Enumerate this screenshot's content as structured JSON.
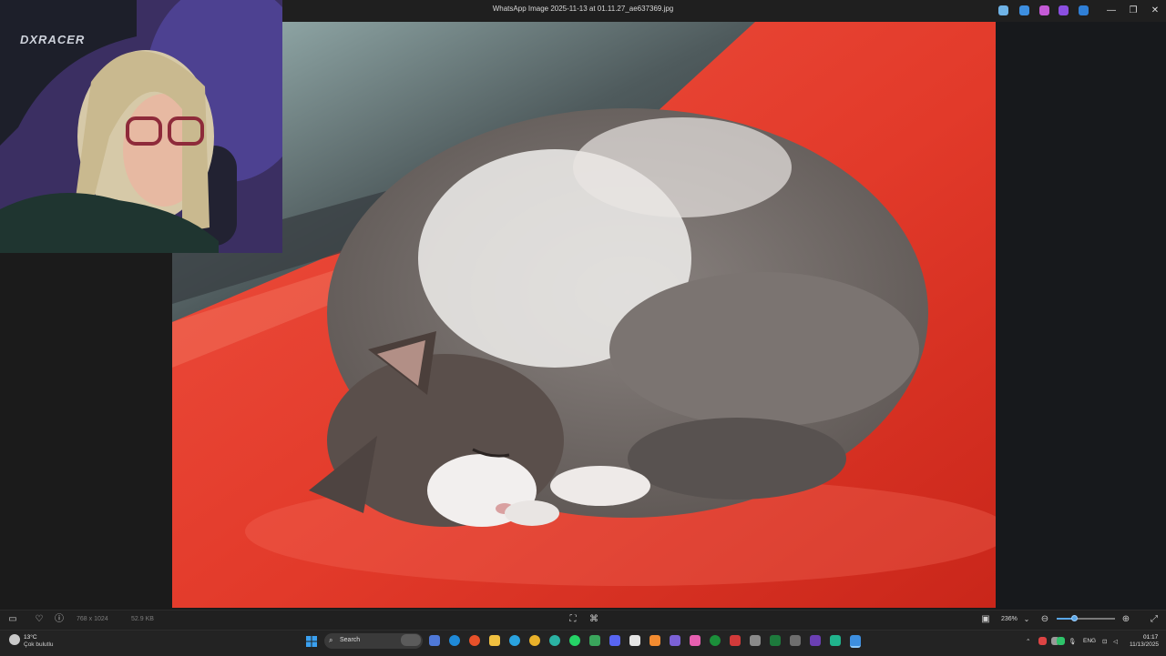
{
  "window": {
    "title": "WhatsApp Image 2025-11-13 at 01.11.27_ae637369.jpg",
    "controls": {
      "minimize": "—",
      "restore": "❐",
      "close": "✕"
    }
  },
  "webcam": {
    "chair_brand": "DXRACER"
  },
  "toolbar": {
    "dimensions": "768 x 1024",
    "file_size": "52.9 KB",
    "zoom": "236%",
    "zoom_level": 0.3
  },
  "taskbar": {
    "weather_temp": "13°C",
    "weather_desc": "Çok bulutlu",
    "search_placeholder": "Search",
    "language": "ENG",
    "time": "01:17",
    "date": "11/13/2025"
  },
  "colors": {
    "accent": "#5aa7e8",
    "car_red": "#e23a2a",
    "cat_grey": "#6d6664"
  }
}
